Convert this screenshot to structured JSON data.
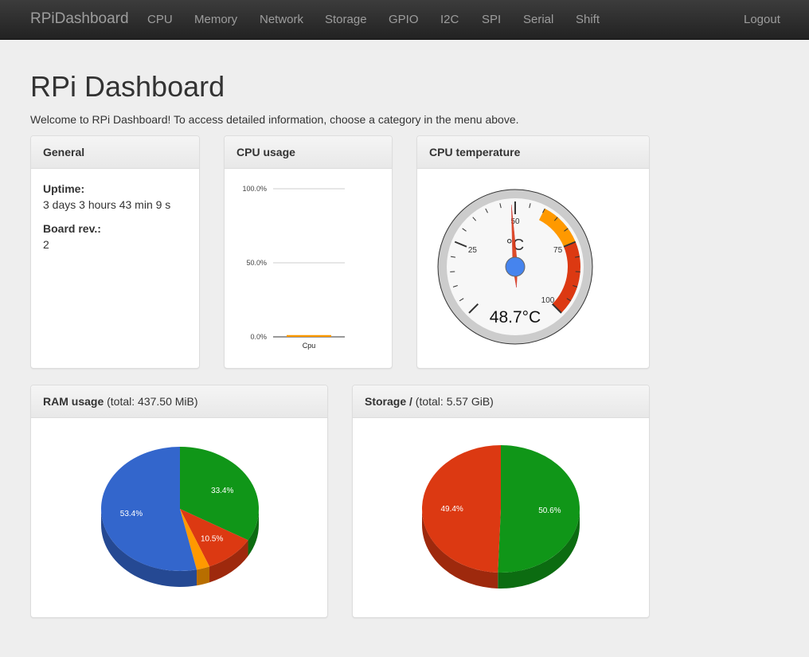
{
  "navbar": {
    "brand": "RPiDashboard",
    "links": [
      "CPU",
      "Memory",
      "Network",
      "Storage",
      "GPIO",
      "I2C",
      "SPI",
      "Serial",
      "Shift"
    ],
    "logout": "Logout"
  },
  "header": {
    "title": "RPi Dashboard",
    "welcome": "Welcome to RPi Dashboard! To access detailed information, choose a category in the menu above."
  },
  "general": {
    "title": "General",
    "uptime_label": "Uptime:",
    "uptime_value": "3 days 3 hours 43 min 9 s",
    "board_label": "Board rev.:",
    "board_value": "2"
  },
  "cpu_usage": {
    "title": "CPU usage"
  },
  "cpu_temp": {
    "title": "CPU temperature"
  },
  "ram": {
    "title": "RAM usage",
    "total": "(total: 437.50 MiB)"
  },
  "storage": {
    "title": "Storage /",
    "total": "(total: 5.57 GiB)"
  },
  "colors": {
    "blue": "#3366cc",
    "green": "#109618",
    "red": "#dc3912",
    "orange": "#ff9900"
  },
  "chart_data": [
    {
      "type": "bar",
      "title": "CPU usage",
      "categories": [
        "Cpu"
      ],
      "values": [
        1.2
      ],
      "ylim": [
        0,
        100
      ],
      "y_ticks": [
        "0.0%",
        "50.0%",
        "100.0%"
      ],
      "color": "#ff9900"
    },
    {
      "type": "gauge",
      "title": "CPU temperature",
      "value": 48.7,
      "value_label": "48.7°C",
      "unit_label": "°C",
      "range": [
        0,
        100
      ],
      "major_ticks": [
        "25",
        "50",
        "75",
        "100"
      ],
      "bands": [
        {
          "from": 60,
          "to": 75,
          "color": "#ff9900"
        },
        {
          "from": 75,
          "to": 100,
          "color": "#dc3912"
        }
      ]
    },
    {
      "type": "pie",
      "title": "RAM usage",
      "slices": [
        {
          "value": 33.4,
          "label": "33.4%",
          "color": "#109618"
        },
        {
          "value": 10.5,
          "label": "10.5%",
          "color": "#dc3912"
        },
        {
          "value": 2.7,
          "label": "",
          "color": "#ff9900"
        },
        {
          "value": 53.4,
          "label": "53.4%",
          "color": "#3366cc"
        }
      ]
    },
    {
      "type": "pie",
      "title": "Storage /",
      "slices": [
        {
          "value": 50.6,
          "label": "50.6%",
          "color": "#109618"
        },
        {
          "value": 49.4,
          "label": "49.4%",
          "color": "#dc3912"
        }
      ]
    }
  ]
}
